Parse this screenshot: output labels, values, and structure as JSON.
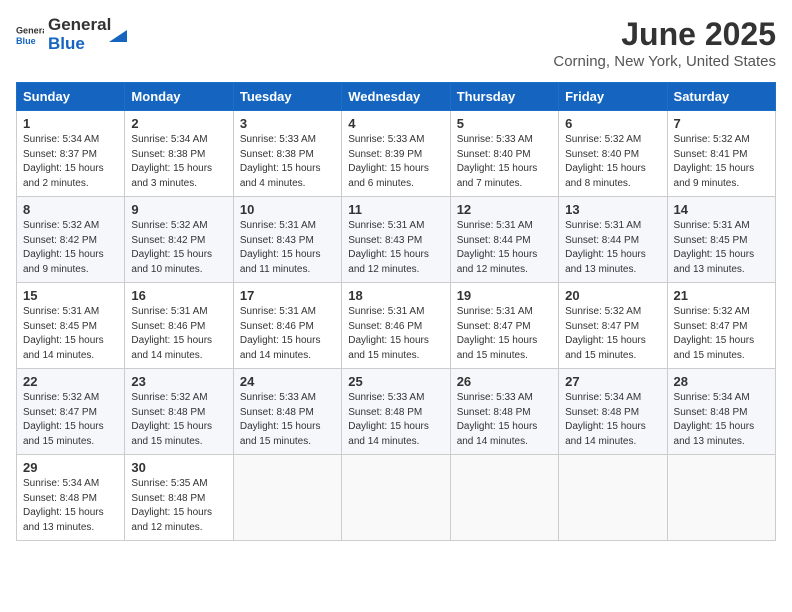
{
  "header": {
    "logo_general": "General",
    "logo_blue": "Blue",
    "month": "June 2025",
    "location": "Corning, New York, United States"
  },
  "days_of_week": [
    "Sunday",
    "Monday",
    "Tuesday",
    "Wednesday",
    "Thursday",
    "Friday",
    "Saturday"
  ],
  "weeks": [
    [
      {
        "day": "1",
        "info": "Sunrise: 5:34 AM\nSunset: 8:37 PM\nDaylight: 15 hours\nand 2 minutes."
      },
      {
        "day": "2",
        "info": "Sunrise: 5:34 AM\nSunset: 8:38 PM\nDaylight: 15 hours\nand 3 minutes."
      },
      {
        "day": "3",
        "info": "Sunrise: 5:33 AM\nSunset: 8:38 PM\nDaylight: 15 hours\nand 4 minutes."
      },
      {
        "day": "4",
        "info": "Sunrise: 5:33 AM\nSunset: 8:39 PM\nDaylight: 15 hours\nand 6 minutes."
      },
      {
        "day": "5",
        "info": "Sunrise: 5:33 AM\nSunset: 8:40 PM\nDaylight: 15 hours\nand 7 minutes."
      },
      {
        "day": "6",
        "info": "Sunrise: 5:32 AM\nSunset: 8:40 PM\nDaylight: 15 hours\nand 8 minutes."
      },
      {
        "day": "7",
        "info": "Sunrise: 5:32 AM\nSunset: 8:41 PM\nDaylight: 15 hours\nand 9 minutes."
      }
    ],
    [
      {
        "day": "8",
        "info": "Sunrise: 5:32 AM\nSunset: 8:42 PM\nDaylight: 15 hours\nand 9 minutes."
      },
      {
        "day": "9",
        "info": "Sunrise: 5:32 AM\nSunset: 8:42 PM\nDaylight: 15 hours\nand 10 minutes."
      },
      {
        "day": "10",
        "info": "Sunrise: 5:31 AM\nSunset: 8:43 PM\nDaylight: 15 hours\nand 11 minutes."
      },
      {
        "day": "11",
        "info": "Sunrise: 5:31 AM\nSunset: 8:43 PM\nDaylight: 15 hours\nand 12 minutes."
      },
      {
        "day": "12",
        "info": "Sunrise: 5:31 AM\nSunset: 8:44 PM\nDaylight: 15 hours\nand 12 minutes."
      },
      {
        "day": "13",
        "info": "Sunrise: 5:31 AM\nSunset: 8:44 PM\nDaylight: 15 hours\nand 13 minutes."
      },
      {
        "day": "14",
        "info": "Sunrise: 5:31 AM\nSunset: 8:45 PM\nDaylight: 15 hours\nand 13 minutes."
      }
    ],
    [
      {
        "day": "15",
        "info": "Sunrise: 5:31 AM\nSunset: 8:45 PM\nDaylight: 15 hours\nand 14 minutes."
      },
      {
        "day": "16",
        "info": "Sunrise: 5:31 AM\nSunset: 8:46 PM\nDaylight: 15 hours\nand 14 minutes."
      },
      {
        "day": "17",
        "info": "Sunrise: 5:31 AM\nSunset: 8:46 PM\nDaylight: 15 hours\nand 14 minutes."
      },
      {
        "day": "18",
        "info": "Sunrise: 5:31 AM\nSunset: 8:46 PM\nDaylight: 15 hours\nand 15 minutes."
      },
      {
        "day": "19",
        "info": "Sunrise: 5:31 AM\nSunset: 8:47 PM\nDaylight: 15 hours\nand 15 minutes."
      },
      {
        "day": "20",
        "info": "Sunrise: 5:32 AM\nSunset: 8:47 PM\nDaylight: 15 hours\nand 15 minutes."
      },
      {
        "day": "21",
        "info": "Sunrise: 5:32 AM\nSunset: 8:47 PM\nDaylight: 15 hours\nand 15 minutes."
      }
    ],
    [
      {
        "day": "22",
        "info": "Sunrise: 5:32 AM\nSunset: 8:47 PM\nDaylight: 15 hours\nand 15 minutes."
      },
      {
        "day": "23",
        "info": "Sunrise: 5:32 AM\nSunset: 8:48 PM\nDaylight: 15 hours\nand 15 minutes."
      },
      {
        "day": "24",
        "info": "Sunrise: 5:33 AM\nSunset: 8:48 PM\nDaylight: 15 hours\nand 15 minutes."
      },
      {
        "day": "25",
        "info": "Sunrise: 5:33 AM\nSunset: 8:48 PM\nDaylight: 15 hours\nand 14 minutes."
      },
      {
        "day": "26",
        "info": "Sunrise: 5:33 AM\nSunset: 8:48 PM\nDaylight: 15 hours\nand 14 minutes."
      },
      {
        "day": "27",
        "info": "Sunrise: 5:34 AM\nSunset: 8:48 PM\nDaylight: 15 hours\nand 14 minutes."
      },
      {
        "day": "28",
        "info": "Sunrise: 5:34 AM\nSunset: 8:48 PM\nDaylight: 15 hours\nand 13 minutes."
      }
    ],
    [
      {
        "day": "29",
        "info": "Sunrise: 5:34 AM\nSunset: 8:48 PM\nDaylight: 15 hours\nand 13 minutes."
      },
      {
        "day": "30",
        "info": "Sunrise: 5:35 AM\nSunset: 8:48 PM\nDaylight: 15 hours\nand 12 minutes."
      },
      null,
      null,
      null,
      null,
      null
    ]
  ]
}
